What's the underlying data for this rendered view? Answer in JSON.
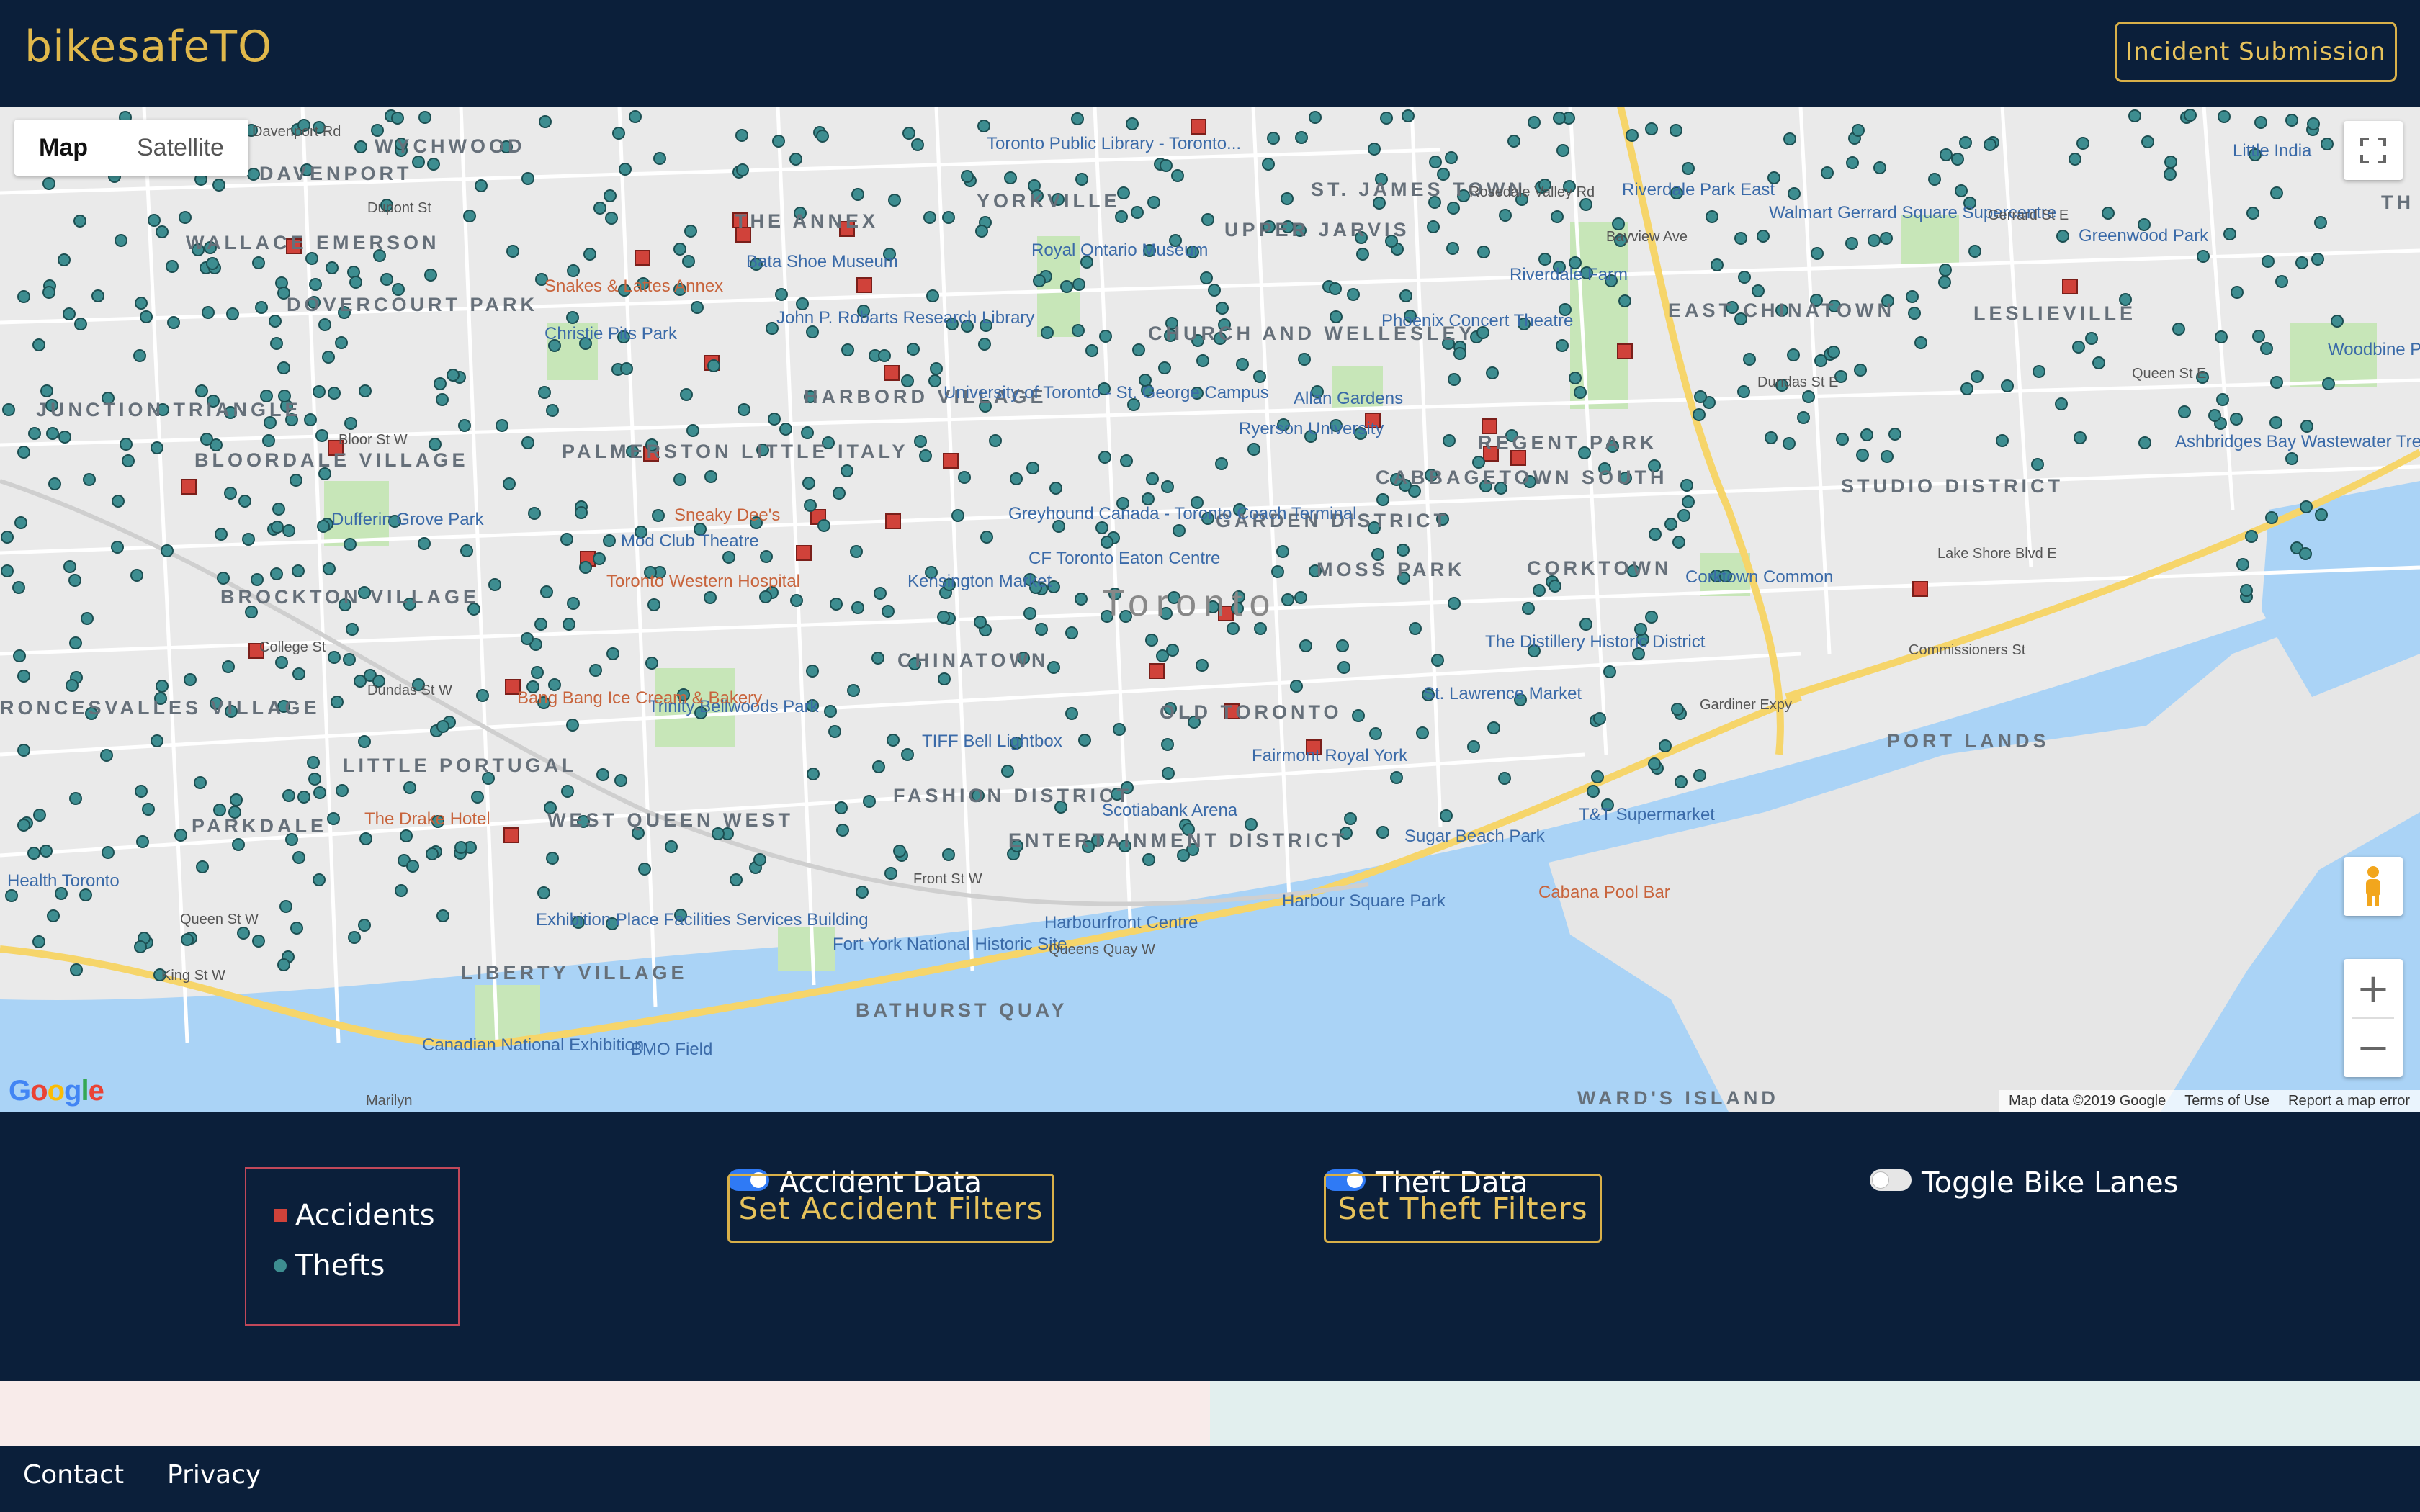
{
  "header": {
    "brand": "bikesafeTO",
    "submit_label": "Incident Submission"
  },
  "map": {
    "type_controls": [
      "Map",
      "Satellite"
    ],
    "active_type": "Map",
    "attribution": [
      "Map data ©2019 Google",
      "Terms of Use",
      "Report a map error"
    ],
    "logo_text": "Google",
    "city_label": "Toronto",
    "districts": [
      "WYCHWOOD",
      "DAVENPORT",
      "WALLACE EMERSON",
      "DOVERCOURT PARK",
      "JUNCTION TRIANGLE",
      "BLOORDALE VILLAGE",
      "PALMERSTON LITTLE ITALY",
      "HARBORD VILLAGE",
      "THE ANNEX",
      "YORKVILLE",
      "ST. JAMES TOWN",
      "UPPER JARVIS",
      "CHURCH AND WELLESLEY",
      "CABBAGETOWN SOUTH",
      "REGENT PARK",
      "GARDEN DISTRICT",
      "MOSS PARK",
      "CORKTOWN",
      "OLD TORONTO",
      "CHINATOWN",
      "FASHION DISTRICT",
      "ENTERTAINMENT DISTRICT",
      "BROCKTON VILLAGE",
      "RONCESVALLES VILLAGE",
      "LITTLE PORTUGAL",
      "PARKDALE",
      "WEST QUEEN WEST",
      "LIBERTY VILLAGE",
      "BATHURST QUAY",
      "EAST CHINATOWN",
      "LESLIEVILLE",
      "STUDIO DISTRICT",
      "PORT LANDS",
      "WARD'S ISLAND",
      "TH"
    ],
    "pois": [
      "Toronto Public Library - Toronto...",
      "Royal Ontario Museum",
      "Bata Shoe Museum",
      "Snakes & Lattes Annex",
      "Christie Pits Park",
      "John P. Robarts Research Library",
      "University of Toronto - St. George Campus",
      "Ryerson University",
      "Allan Gardens",
      "Phoenix Concert Theatre",
      "Riverdale Park East",
      "Riverdale Farm",
      "Walmart Gerrard Square Supercentre",
      "Greenwood Park",
      "Little India",
      "Woodbine Park",
      "Ashbridges Bay Wastewater Treatment...",
      "Dufferin Grove Park",
      "Sneaky Dee's",
      "Mod Club Theatre",
      "Toronto Western Hospital",
      "Kensington Market",
      "Greyhound Canada - Toronto Coach Terminal",
      "CF Toronto Eaton Centre",
      "The Distillery Historic District",
      "St. Lawrence Market",
      "Corktown Common",
      "Trinity Bellwoods Park",
      "Bang Bang Ice Cream & Bakery",
      "TIFF Bell Lightbox",
      "Fairmont Royal York",
      "Scotiabank Arena",
      "Sugar Beach Park",
      "T&T Supermarket",
      "Cabana Pool Bar",
      "Harbour Square Park",
      "Harbourfront Centre",
      "Fort York National Historic Site",
      "Exhibition Place Facilities Services Building",
      "The Drake Hotel",
      "Canadian National Exhibition",
      "BMO Field",
      "Health Toronto"
    ],
    "roads": [
      "Davenport Rd",
      "Dupont St",
      "Bloor St W",
      "College St",
      "Dundas St W",
      "Queen St W",
      "King St W",
      "Gardiner Expy",
      "Lake Shore Blvd E",
      "Commissioners St",
      "Gerrard St E",
      "Queen St E",
      "Dundas St E",
      "Bayview Ave",
      "Rosedale Valley Rd",
      "Front St W",
      "Queens Quay W",
      "Marilyn"
    ],
    "incident_summary": {
      "accidents_markers": 40,
      "thefts_markers": "many"
    }
  },
  "legend": {
    "accidents_label": "Accidents",
    "thefts_label": "Thefts",
    "accident_color": "#d0423a",
    "theft_color": "#3d8d90"
  },
  "controls": {
    "accident_toggle_label": "Accident Data",
    "accident_toggle_on": true,
    "accident_filter_label": "Set Accident Filters",
    "theft_toggle_label": "Theft Data",
    "theft_toggle_on": true,
    "theft_filter_label": "Set Theft Filters",
    "bikelanes_toggle_label": "Toggle Bike Lanes",
    "bikelanes_toggle_on": false
  },
  "footer": {
    "contact": "Contact",
    "privacy": "Privacy"
  },
  "colors": {
    "navy": "#0b1f3a",
    "gold": "#d9b049",
    "toggle_on": "#2f7af5"
  }
}
